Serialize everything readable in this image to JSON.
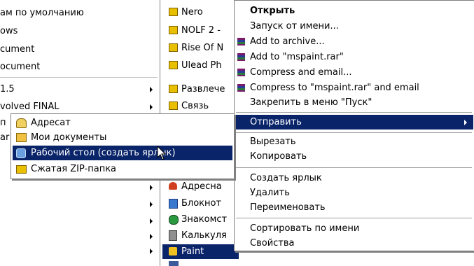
{
  "left_column": [
    {
      "label": "ам по умолчанию",
      "arrow": false
    },
    {
      "label": "ows",
      "arrow": false
    },
    {
      "label": "cument",
      "arrow": false
    },
    {
      "label": "ocument",
      "arrow": false
    },
    {
      "label": "1.5",
      "arrow": true
    },
    {
      "label": "volved FINAL",
      "arrow": true
    },
    {
      "label": "п",
      "arrow": true
    },
    {
      "label": "ar",
      "arrow": true
    }
  ],
  "middle_column_top": [
    {
      "label": "Nero",
      "icon": "program-group-icon"
    },
    {
      "label": "NOLF 2 -",
      "icon": "program-group-icon"
    },
    {
      "label": "Rise Of N",
      "icon": "program-group-icon"
    },
    {
      "label": "Ulead Ph",
      "icon": "program-group-icon"
    },
    {
      "label": "Развлече",
      "icon": "program-group-icon"
    },
    {
      "label": "Связь",
      "icon": "program-group-icon"
    }
  ],
  "middle_column_bottom": [
    {
      "label": "Адресна",
      "icon": "address-book-icon"
    },
    {
      "label": "Блокнот",
      "icon": "notepad-icon"
    },
    {
      "label": "Знакомст",
      "icon": "tour-icon"
    },
    {
      "label": "Калькуля",
      "icon": "calculator-icon"
    },
    {
      "label": "Paint",
      "icon": "paint-icon",
      "selected": true
    }
  ],
  "sendto_submenu": [
    {
      "label": "Адресат",
      "icon": "mail-recipient-icon"
    },
    {
      "label": "Мои документы",
      "icon": "my-documents-icon"
    },
    {
      "label": "Рабочий стол (создать ярлык)",
      "icon": "desktop-icon",
      "selected": true
    },
    {
      "label": "Сжатая ZIP-папка",
      "icon": "zip-folder-icon"
    }
  ],
  "context_menu": {
    "group1": [
      {
        "label": "Открыть",
        "bold": true
      },
      {
        "label": "Запуск от имени..."
      },
      {
        "label": "Add to archive...",
        "icon": "winrar-icon"
      },
      {
        "label": "Add to \"mspaint.rar\"",
        "icon": "winrar-icon"
      },
      {
        "label": "Compress and email...",
        "icon": "winrar-icon"
      },
      {
        "label": "Compress to \"mspaint.rar\" and email",
        "icon": "winrar-icon"
      },
      {
        "label": "Закрепить в меню \"Пуск\""
      }
    ],
    "send_to": {
      "label": "Отправить",
      "selected": true
    },
    "group2": [
      {
        "label": "Вырезать"
      },
      {
        "label": "Копировать"
      }
    ],
    "group3": [
      {
        "label": "Создать ярлык"
      },
      {
        "label": "Удалить"
      },
      {
        "label": "Переименовать"
      }
    ],
    "group4": [
      {
        "label": "Сортировать по имени"
      },
      {
        "label": "Свойства"
      }
    ]
  },
  "colors": {
    "selection": "#0a246a",
    "menu_bg": "#ffffff",
    "separator": "#a0a0a0"
  }
}
